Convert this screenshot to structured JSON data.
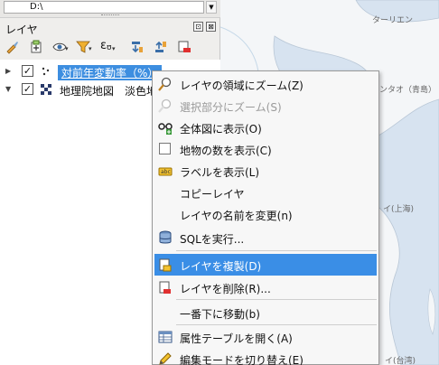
{
  "browser": {
    "path": "D:\\"
  },
  "panel": {
    "title": "レイヤ",
    "float_glyph": "⊡",
    "close_glyph": "⊠"
  },
  "toolbar": {
    "icons": [
      "style-brush-icon",
      "add-group-icon",
      "visibility-eye-icon",
      "filter-funnel-icon",
      "expression-filter-icon",
      "expand-all-icon",
      "collapse-all-icon",
      "remove-layer-icon"
    ],
    "expression_glyph": "ε",
    "expression_sub": "ʊ"
  },
  "layers": [
    {
      "name": "対前年変動率（%）",
      "checked": true,
      "expanded": false,
      "selected": true
    },
    {
      "name": "地理院地図　淡色地",
      "checked": true,
      "expanded": true,
      "selected": false
    }
  ],
  "tree_glyphs": {
    "collapsed": "▶",
    "expanded": "▼",
    "check": "✓"
  },
  "context_menu": {
    "items": [
      {
        "label": "レイヤの領域にズーム(Z)",
        "icon": "zoom-magnifier-icon",
        "disabled": false
      },
      {
        "label": "選択部分にズーム(S)",
        "icon": "zoom-selection-icon",
        "disabled": true
      },
      {
        "label": "全体図に表示(O)",
        "icon": "overview-glasses-icon",
        "disabled": false
      },
      {
        "label": "地物の数を表示(C)",
        "icon": "checkbox-icon",
        "disabled": false
      },
      {
        "label": "ラベルを表示(L)",
        "icon": "label-abc-icon",
        "disabled": false
      },
      {
        "label": "コピーレイヤ",
        "icon": "",
        "disabled": false
      },
      {
        "label": "レイヤの名前を変更(n)",
        "icon": "",
        "disabled": false
      },
      {
        "label": "SQLを実行...",
        "icon": "database-icon",
        "disabled": false
      },
      {
        "label": "レイヤを複製(D)",
        "icon": "duplicate-layer-icon",
        "disabled": false,
        "highlighted": true
      },
      {
        "label": "レイヤを削除(R)...",
        "icon": "remove-layer-icon",
        "disabled": false
      },
      {
        "label": "一番下に移動(b)",
        "icon": "",
        "disabled": false
      },
      {
        "label": "属性テーブルを開く(A)",
        "icon": "attribute-table-icon",
        "disabled": false
      },
      {
        "label": "編集モードを切り替え(E)",
        "icon": "pencil-icon",
        "disabled": false
      }
    ]
  },
  "map": {
    "labels": [
      "ターリエン",
      "ンタオ（青島）",
      "イ(上海)",
      "イ(台湾)"
    ],
    "land_color": "#f4f6f8",
    "sea_color": "#d7e3f0"
  }
}
